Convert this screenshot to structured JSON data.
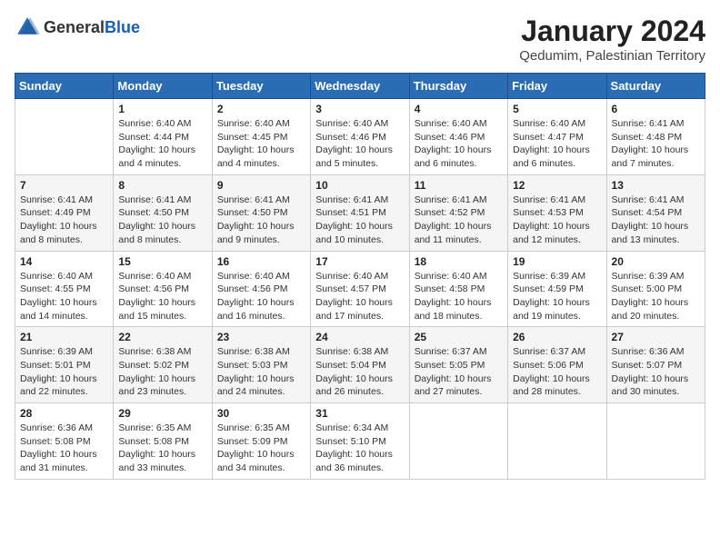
{
  "logo": {
    "general": "General",
    "blue": "Blue"
  },
  "title": "January 2024",
  "subtitle": "Qedumim, Palestinian Territory",
  "headers": [
    "Sunday",
    "Monday",
    "Tuesday",
    "Wednesday",
    "Thursday",
    "Friday",
    "Saturday"
  ],
  "weeks": [
    [
      {
        "day": "",
        "info": ""
      },
      {
        "day": "1",
        "info": "Sunrise: 6:40 AM\nSunset: 4:44 PM\nDaylight: 10 hours\nand 4 minutes."
      },
      {
        "day": "2",
        "info": "Sunrise: 6:40 AM\nSunset: 4:45 PM\nDaylight: 10 hours\nand 4 minutes."
      },
      {
        "day": "3",
        "info": "Sunrise: 6:40 AM\nSunset: 4:46 PM\nDaylight: 10 hours\nand 5 minutes."
      },
      {
        "day": "4",
        "info": "Sunrise: 6:40 AM\nSunset: 4:46 PM\nDaylight: 10 hours\nand 6 minutes."
      },
      {
        "day": "5",
        "info": "Sunrise: 6:40 AM\nSunset: 4:47 PM\nDaylight: 10 hours\nand 6 minutes."
      },
      {
        "day": "6",
        "info": "Sunrise: 6:41 AM\nSunset: 4:48 PM\nDaylight: 10 hours\nand 7 minutes."
      }
    ],
    [
      {
        "day": "7",
        "info": "Sunrise: 6:41 AM\nSunset: 4:49 PM\nDaylight: 10 hours\nand 8 minutes."
      },
      {
        "day": "8",
        "info": "Sunrise: 6:41 AM\nSunset: 4:50 PM\nDaylight: 10 hours\nand 8 minutes."
      },
      {
        "day": "9",
        "info": "Sunrise: 6:41 AM\nSunset: 4:50 PM\nDaylight: 10 hours\nand 9 minutes."
      },
      {
        "day": "10",
        "info": "Sunrise: 6:41 AM\nSunset: 4:51 PM\nDaylight: 10 hours\nand 10 minutes."
      },
      {
        "day": "11",
        "info": "Sunrise: 6:41 AM\nSunset: 4:52 PM\nDaylight: 10 hours\nand 11 minutes."
      },
      {
        "day": "12",
        "info": "Sunrise: 6:41 AM\nSunset: 4:53 PM\nDaylight: 10 hours\nand 12 minutes."
      },
      {
        "day": "13",
        "info": "Sunrise: 6:41 AM\nSunset: 4:54 PM\nDaylight: 10 hours\nand 13 minutes."
      }
    ],
    [
      {
        "day": "14",
        "info": "Sunrise: 6:40 AM\nSunset: 4:55 PM\nDaylight: 10 hours\nand 14 minutes."
      },
      {
        "day": "15",
        "info": "Sunrise: 6:40 AM\nSunset: 4:56 PM\nDaylight: 10 hours\nand 15 minutes."
      },
      {
        "day": "16",
        "info": "Sunrise: 6:40 AM\nSunset: 4:56 PM\nDaylight: 10 hours\nand 16 minutes."
      },
      {
        "day": "17",
        "info": "Sunrise: 6:40 AM\nSunset: 4:57 PM\nDaylight: 10 hours\nand 17 minutes."
      },
      {
        "day": "18",
        "info": "Sunrise: 6:40 AM\nSunset: 4:58 PM\nDaylight: 10 hours\nand 18 minutes."
      },
      {
        "day": "19",
        "info": "Sunrise: 6:39 AM\nSunset: 4:59 PM\nDaylight: 10 hours\nand 19 minutes."
      },
      {
        "day": "20",
        "info": "Sunrise: 6:39 AM\nSunset: 5:00 PM\nDaylight: 10 hours\nand 20 minutes."
      }
    ],
    [
      {
        "day": "21",
        "info": "Sunrise: 6:39 AM\nSunset: 5:01 PM\nDaylight: 10 hours\nand 22 minutes."
      },
      {
        "day": "22",
        "info": "Sunrise: 6:38 AM\nSunset: 5:02 PM\nDaylight: 10 hours\nand 23 minutes."
      },
      {
        "day": "23",
        "info": "Sunrise: 6:38 AM\nSunset: 5:03 PM\nDaylight: 10 hours\nand 24 minutes."
      },
      {
        "day": "24",
        "info": "Sunrise: 6:38 AM\nSunset: 5:04 PM\nDaylight: 10 hours\nand 26 minutes."
      },
      {
        "day": "25",
        "info": "Sunrise: 6:37 AM\nSunset: 5:05 PM\nDaylight: 10 hours\nand 27 minutes."
      },
      {
        "day": "26",
        "info": "Sunrise: 6:37 AM\nSunset: 5:06 PM\nDaylight: 10 hours\nand 28 minutes."
      },
      {
        "day": "27",
        "info": "Sunrise: 6:36 AM\nSunset: 5:07 PM\nDaylight: 10 hours\nand 30 minutes."
      }
    ],
    [
      {
        "day": "28",
        "info": "Sunrise: 6:36 AM\nSunset: 5:08 PM\nDaylight: 10 hours\nand 31 minutes."
      },
      {
        "day": "29",
        "info": "Sunrise: 6:35 AM\nSunset: 5:08 PM\nDaylight: 10 hours\nand 33 minutes."
      },
      {
        "day": "30",
        "info": "Sunrise: 6:35 AM\nSunset: 5:09 PM\nDaylight: 10 hours\nand 34 minutes."
      },
      {
        "day": "31",
        "info": "Sunrise: 6:34 AM\nSunset: 5:10 PM\nDaylight: 10 hours\nand 36 minutes."
      },
      {
        "day": "",
        "info": ""
      },
      {
        "day": "",
        "info": ""
      },
      {
        "day": "",
        "info": ""
      }
    ]
  ]
}
